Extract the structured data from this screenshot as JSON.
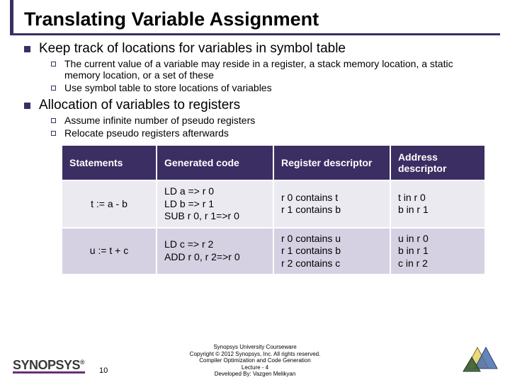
{
  "title": "Translating Variable Assignment",
  "bullets": {
    "b1": "Keep track of locations for variables in symbol table",
    "b1_1": "The current value of a variable may reside in a register, a stack memory location, a static memory location, or a set of these",
    "b1_2": "Use symbol table to store locations of variables",
    "b2": "Allocation of variables to registers",
    "b2_1": "Assume infinite number of pseudo registers",
    "b2_2": "Relocate pseudo registers afterwards"
  },
  "table": {
    "headers": {
      "stmt": "Statements",
      "gen": "Generated code",
      "reg": "Register descriptor",
      "addr": "Address descriptor"
    },
    "rows": [
      {
        "stmt": "t := a - b",
        "gen": "LD  a => r 0\nLD  b => r 1\nSUB  r 0, r 1=>r 0",
        "reg": "r 0 contains t\nr 1 contains b",
        "addr": "t in r 0\nb in r 1"
      },
      {
        "stmt": "u := t + c",
        "gen": "LD c => r 2\nADD r 0, r 2=>r 0",
        "reg": "r 0 contains u\nr 1 contains b\nr 2 contains c",
        "addr": "u in r 0\nb in r 1\nc in r 2"
      }
    ]
  },
  "footer": {
    "l1": "Synopsys University Courseware",
    "l2": "Copyright © 2012 Synopsys, Inc. All rights reserved.",
    "l3": "Compiler Optimization and Code Generation",
    "l4": "Lecture - 4",
    "l5": "Developed By: Vazgen Melikyan"
  },
  "page": "10",
  "logo_text": "SYNOPSYS"
}
